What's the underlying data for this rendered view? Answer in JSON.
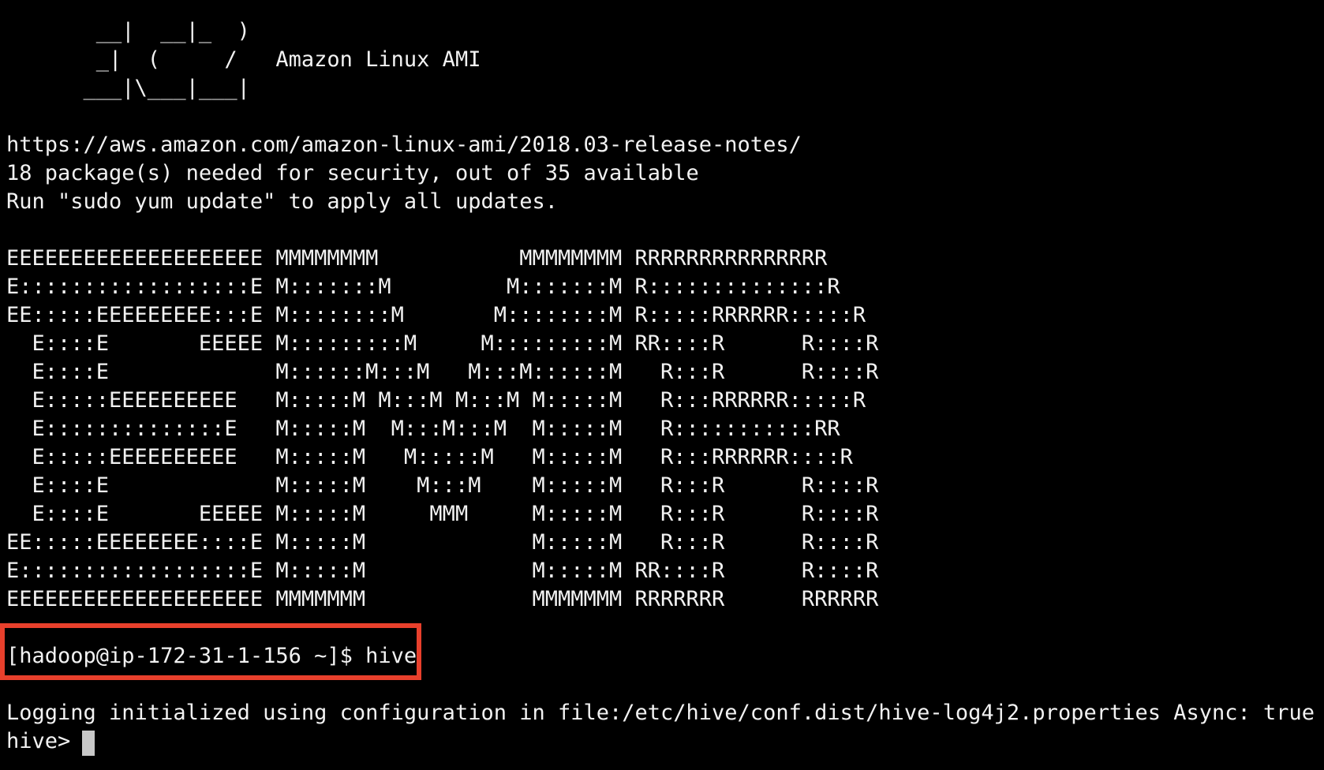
{
  "terminal": {
    "banner": [
      "       __|  __|_  )",
      "       _|  (     /   Amazon Linux AMI",
      "      ___|\\___|___|"
    ],
    "motd": [
      "https://aws.amazon.com/amazon-linux-ami/2018.03-release-notes/",
      "18 package(s) needed for security, out of 35 available",
      "Run \"sudo yum update\" to apply all updates."
    ],
    "emr_logo": [
      "EEEEEEEEEEEEEEEEEEEE MMMMMMMM           MMMMMMMM RRRRRRRRRRRRRRR",
      "E::::::::::::::::::E M:::::::M         M:::::::M R::::::::::::::R",
      "EE:::::EEEEEEEEE:::E M::::::::M       M::::::::M R:::::RRRRRR:::::R",
      "  E::::E       EEEEE M:::::::::M     M:::::::::M RR::::R      R::::R",
      "  E::::E             M::::::M:::M   M:::M::::::M   R:::R      R::::R",
      "  E:::::EEEEEEEEEE   M:::::M M:::M M:::M M:::::M   R:::RRRRRR:::::R",
      "  E::::::::::::::E   M:::::M  M:::M:::M  M:::::M   R:::::::::::RR",
      "  E:::::EEEEEEEEEE   M:::::M   M:::::M   M:::::M   R:::RRRRRR::::R",
      "  E::::E             M:::::M    M:::M    M:::::M   R:::R      R::::R",
      "  E::::E       EEEEE M:::::M     MMM     M:::::M   R:::R      R::::R",
      "EE:::::EEEEEEEE::::E M:::::M             M:::::M   R:::R      R::::R",
      "E::::::::::::::::::E M:::::M             M:::::M RR::::R      R::::R",
      "EEEEEEEEEEEEEEEEEEEE MMMMMMM             MMMMMMM RRRRRRR      RRRRRR"
    ],
    "command_line": "[hadoop@ip-172-31-1-156 ~]$ hive",
    "log_line": "Logging initialized using configuration in file:/etc/hive/conf.dist/hive-log4j2.properties Async: true",
    "prompt": "hive> "
  }
}
